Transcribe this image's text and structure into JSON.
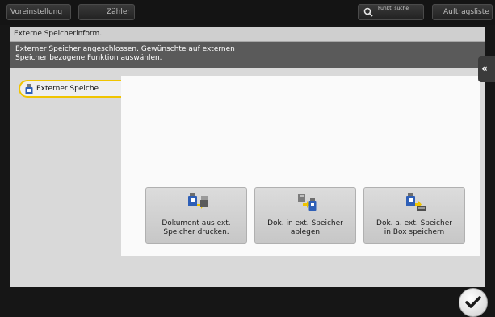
{
  "top_bar": {
    "preset_label": "Voreinstellung",
    "counter_label": "Zähler",
    "search_label": "Funkt. suche",
    "job_list_label": "Auftragsliste"
  },
  "panel": {
    "title": "Externe Speicherinform.",
    "message": "Externer Speicher angeschlossen. Gewünschte auf externen\nSpeicher bezogene Funktion auswählen.",
    "tab_label": "Externer Speiche"
  },
  "functions": [
    {
      "label": "Dokument aus ext.\nSpeicher drucken.",
      "icon": "print-from-usb-icon"
    },
    {
      "label": "Dok. in ext. Speicher\nablegen",
      "icon": "save-to-usb-icon"
    },
    {
      "label": "Dok. a. ext. Speicher\nin Box speichern",
      "icon": "usb-to-box-icon"
    }
  ],
  "colors": {
    "tab_highlight": "#f0c400",
    "message_bar": "#5a5a5a",
    "icon_blue": "#2e5fb7"
  }
}
